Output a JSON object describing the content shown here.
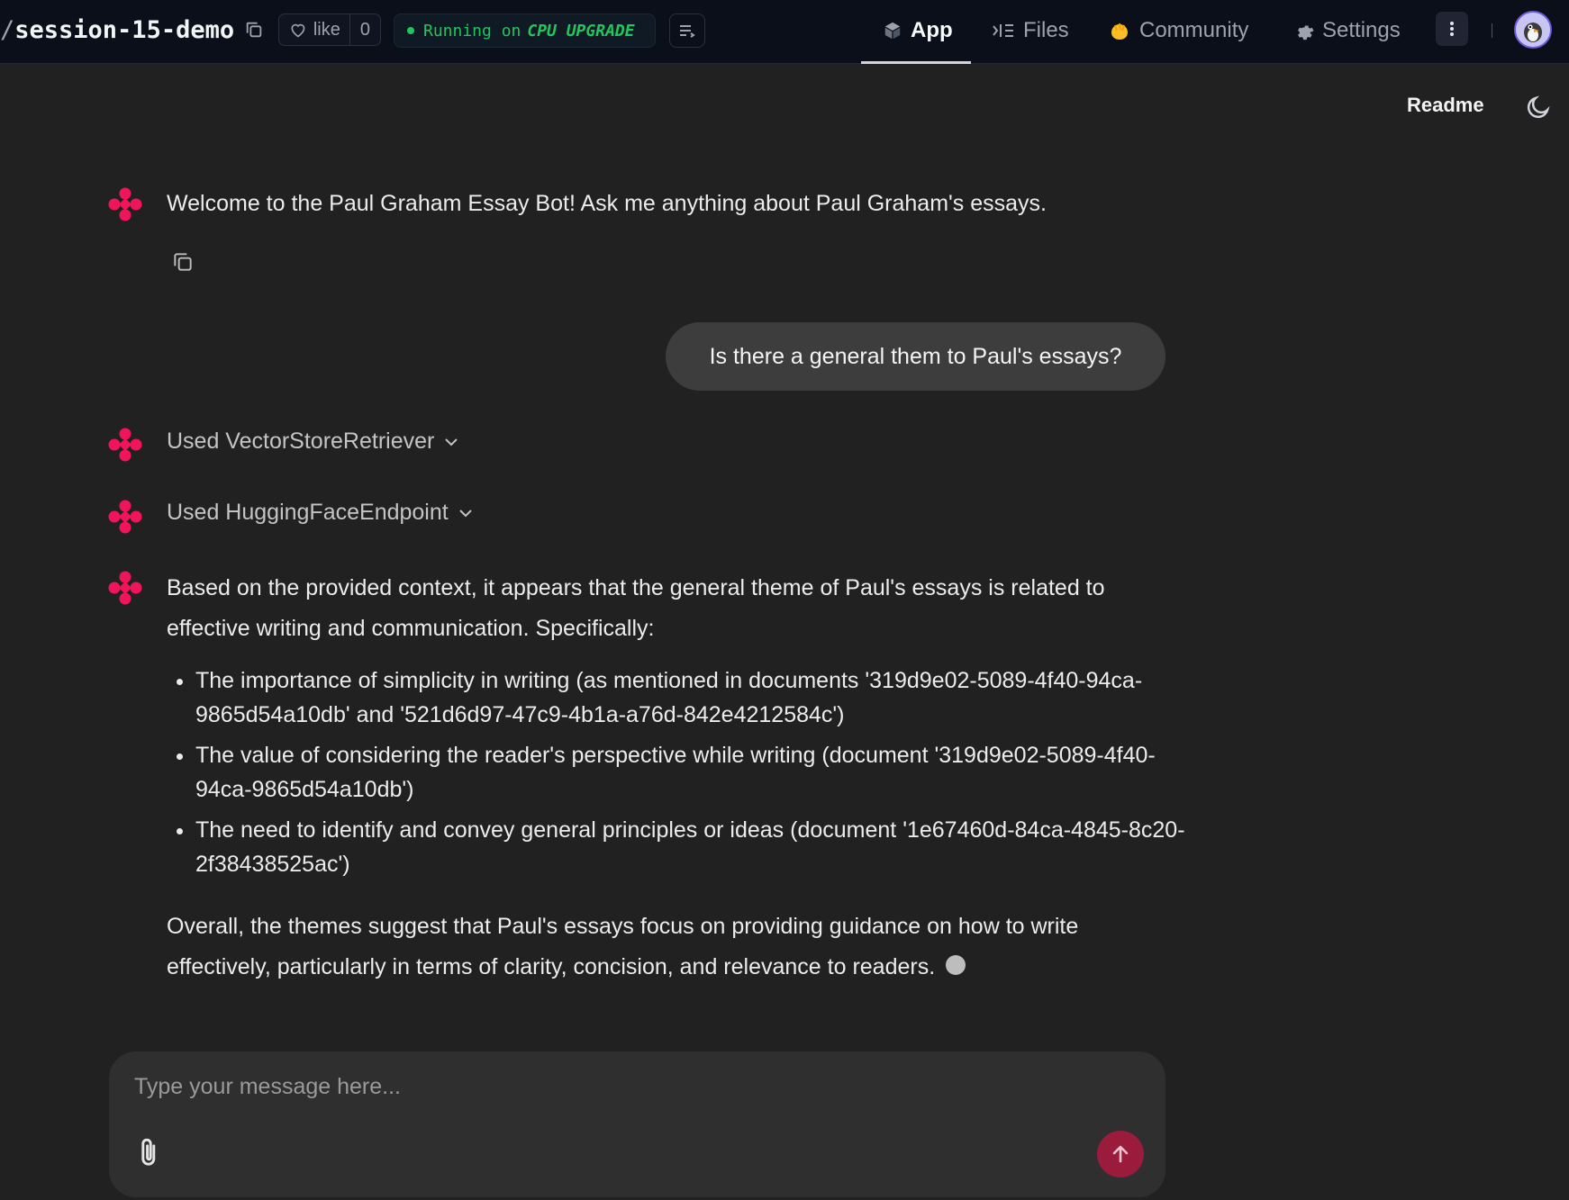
{
  "header": {
    "repo_slash": "/",
    "repo_name": "session-15-demo",
    "like_label": "like",
    "like_count": "0",
    "status_prefix": "Running on",
    "status_hardware": "CPU UPGRADE",
    "tabs": [
      {
        "label": "App",
        "icon": "cube-icon",
        "active": true
      },
      {
        "label": "Files",
        "icon": "files-icon",
        "active": false
      },
      {
        "label": "Community",
        "icon": "community-icon",
        "active": false
      },
      {
        "label": "Settings",
        "icon": "gear-icon",
        "active": false
      }
    ]
  },
  "app": {
    "readme_label": "Readme",
    "welcome_message": "Welcome to the Paul Graham Essay Bot! Ask me anything about Paul Graham's essays.",
    "user_message": "Is there a general them to Paul's essays?",
    "tool_steps": [
      {
        "label": "Used VectorStoreRetriever"
      },
      {
        "label": "Used HuggingFaceEndpoint"
      }
    ],
    "answer": {
      "intro": "Based on the provided context, it appears that the general theme of Paul's essays is related to effective writing and communication. Specifically:",
      "bullets": [
        "The importance of simplicity in writing (as mentioned in documents '319d9e02-5089-4f40-94ca-9865d54a10db' and '521d6d97-47c9-4b1a-a76d-842e4212584c')",
        "The value of considering the reader's perspective while writing (document '319d9e02-5089-4f40-94ca-9865d54a10db')",
        "The need to identify and convey general principles or ideas (document '1e67460d-84ca-4845-8c20-2f38438525ac')"
      ],
      "conclusion": "Overall, the themes suggest that Paul's essays focus on providing guidance on how to write effectively, particularly in terms of clarity, concision, and relevance to readers."
    },
    "composer": {
      "placeholder": "Type your message here...",
      "value": ""
    }
  },
  "colors": {
    "background": "#212121",
    "header_bg": "#0b0f19",
    "brand_pink": "#f0145a",
    "send_button": "#9b1b3d",
    "status_green": "#22c55e",
    "user_bubble": "#3d3d3d"
  }
}
